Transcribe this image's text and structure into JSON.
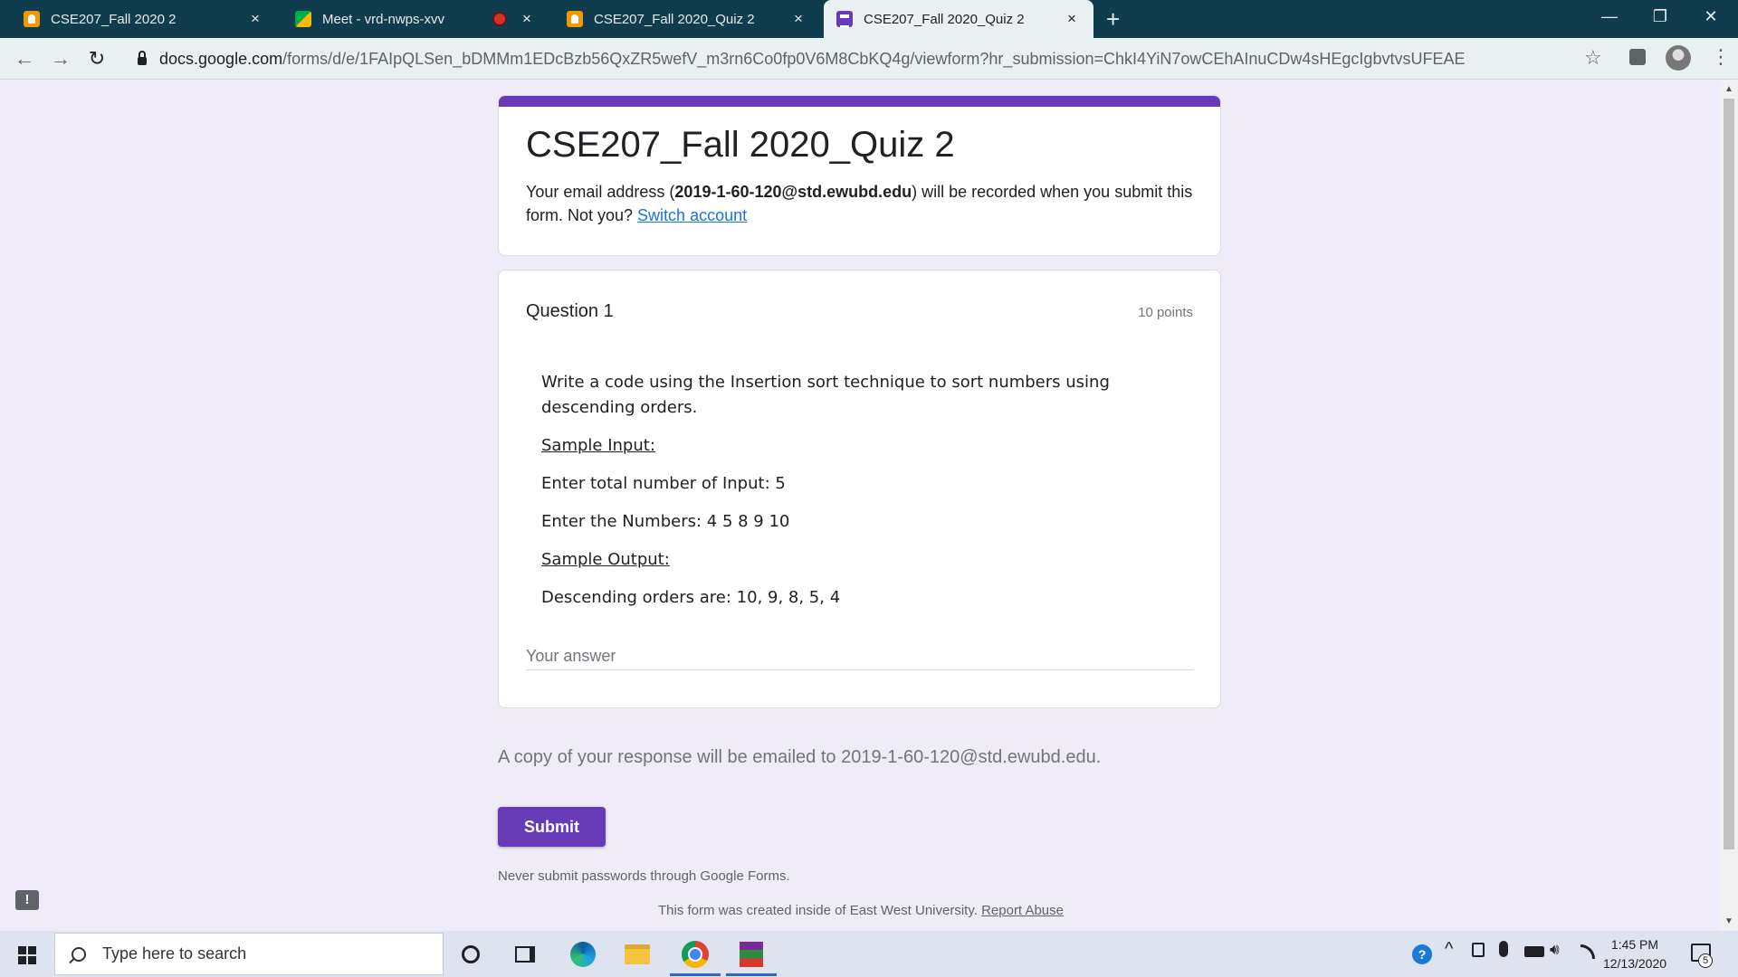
{
  "browser": {
    "tabs": [
      {
        "title": "CSE207_Fall 2020 2",
        "favicon": "slides-icon",
        "close": "×"
      },
      {
        "title": "Meet - vrd-nwps-xvv",
        "favicon": "meet-icon",
        "close": "×",
        "recording": true
      },
      {
        "title": "CSE207_Fall 2020_Quiz 2",
        "favicon": "slides-icon",
        "close": "×"
      },
      {
        "title": "CSE207_Fall 2020_Quiz 2",
        "favicon": "forms-icon",
        "close": "×",
        "active": true
      }
    ],
    "new_tab": "+",
    "window": {
      "minimize": "—",
      "restore": "❐",
      "close": "✕"
    },
    "url_host": "docs.google.com",
    "url_path": "/forms/d/e/1FAIpQLSen_bDMMm1EDcBzb56QxZR5wefV_m3rn6Co0fp0V6M8CbKQ4g/viewform?hr_submission=ChkI4YiN7owCEhAInuCDw4sHEgcIgbvtvsUFEAE",
    "back": "←",
    "forward": "→",
    "reload": "↻",
    "star": "☆",
    "menu": "⋮"
  },
  "form": {
    "accent_color": "#673ab7",
    "title": "CSE207_Fall 2020_Quiz 2",
    "email_prefix": "Your email address (",
    "email": "2019-1-60-120@std.ewubd.edu",
    "email_suffix": ") will be recorded when you submit this form. Not you? ",
    "switch_account": "Switch account",
    "question": {
      "title": "Question 1",
      "points": "10 points",
      "body": [
        "Write a code using the Insertion sort technique to sort numbers using descending orders.",
        "Sample Input:",
        "Enter total number of Input: 5",
        "Enter the Numbers: 4 5 8 9 10",
        "Sample Output:",
        "Descending orders are: 10, 9, 8, 5, 4"
      ],
      "answer_placeholder": "Your answer"
    },
    "copy_note": "A copy of your response will be emailed to 2019-1-60-120@std.ewubd.edu.",
    "submit_label": "Submit",
    "never_submit": "Never submit passwords through Google Forms.",
    "created_by": "This form was created inside of East West University.",
    "report_abuse": "Report Abuse",
    "feedback_icon": "!"
  },
  "taskbar": {
    "search_placeholder": "Type here to search",
    "time": "1:45 PM",
    "date": "12/13/2020",
    "notification_count": "5",
    "tray_help": "?",
    "tray_chevron": "^",
    "tray_volume": "🔊︎"
  }
}
